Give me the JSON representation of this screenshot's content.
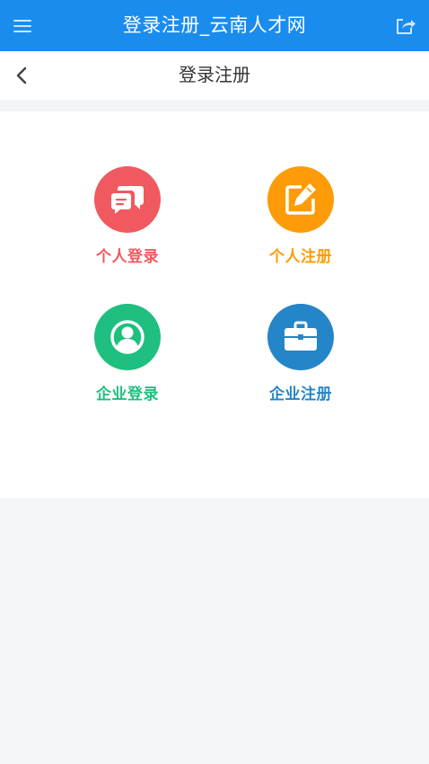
{
  "topbar": {
    "title": "登录注册_云南人才网",
    "menu_icon": "hamburger-menu-icon",
    "share_icon": "share-icon",
    "background": "#1a8cee"
  },
  "navbar": {
    "back_icon": "chevron-left-icon",
    "page_title": "登录注册"
  },
  "tiles": [
    {
      "label": "个人登录",
      "icon": "chat-bubbles-icon",
      "color": "#f0595f"
    },
    {
      "label": "个人注册",
      "icon": "edit-icon",
      "color": "#fd9b09"
    },
    {
      "label": "企业登录",
      "icon": "user-avatar-icon",
      "color": "#1fbf7f"
    },
    {
      "label": "企业注册",
      "icon": "briefcase-icon",
      "color": "#2485c8"
    }
  ]
}
